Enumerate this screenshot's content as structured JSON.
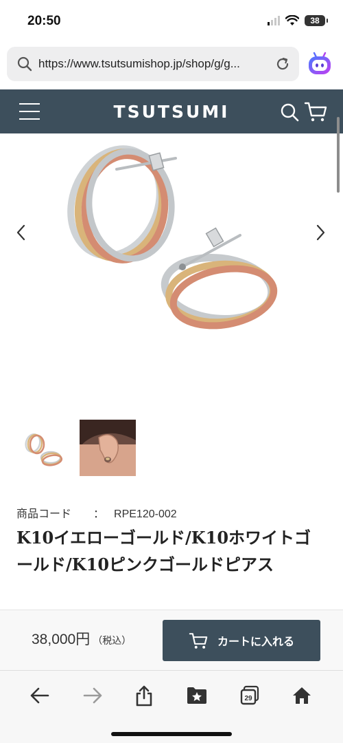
{
  "status": {
    "time": "20:50",
    "battery": "38"
  },
  "browser": {
    "url": "https://www.tsutsumishop.jp/shop/g/g..."
  },
  "header": {
    "brand": "TSUTSUMI"
  },
  "product": {
    "code_label": "商品コード",
    "code_sep": "：",
    "code": "RPE120-002",
    "title": "K10イエローゴールド/K10ホワイトゴールド/K10ピンクゴールドピアス"
  },
  "buy_bar": {
    "price": "38,000円",
    "tax": "（税込）",
    "cart_label": "カートに入れる"
  },
  "toolbar": {
    "tabs_count": "29"
  },
  "colors": {
    "header_bg": "#3d4f5c",
    "accent": "#3d4f5c"
  }
}
